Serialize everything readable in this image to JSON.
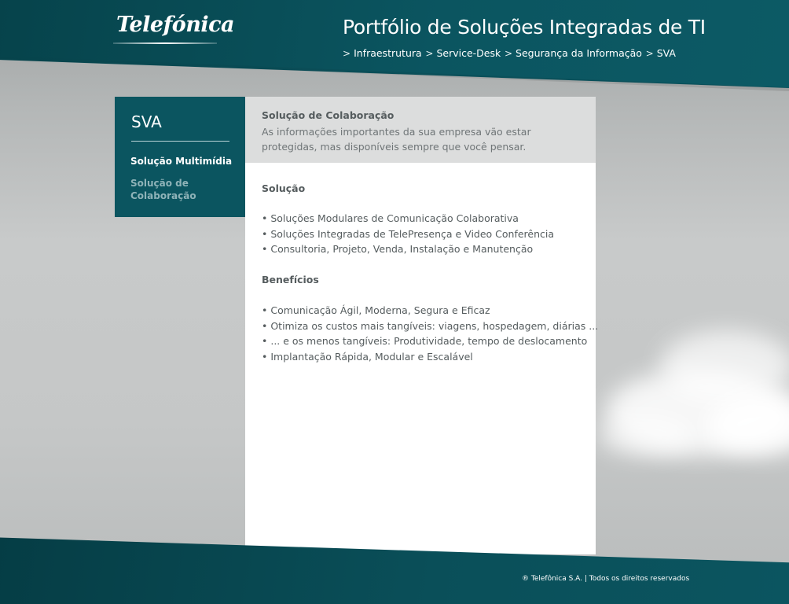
{
  "header": {
    "logo_text": "Telefónica",
    "title": "Portfólio de Soluções Integradas de TI",
    "nav": [
      {
        "label": "Infraestrutura"
      },
      {
        "label": "Service-Desk"
      },
      {
        "label": "Segurança da Informação"
      },
      {
        "label": "SVA"
      }
    ],
    "chevron": ">"
  },
  "sidebar": {
    "title": "SVA",
    "items": [
      {
        "label": "Solução Multimídia"
      },
      {
        "label": "Solução de Colaboração"
      }
    ]
  },
  "content": {
    "title": "Solução de Colaboração",
    "subtitle": "As informações importantes da sua empresa vão estar protegidas, mas disponíveis sempre que você pensar.",
    "sections": [
      {
        "heading": "Solução",
        "bullets": [
          "• Soluções Modulares de Comunicação Colaborativa",
          "• Soluções Integradas de TelePresença e Video Conferência",
          "• Consultoria, Projeto, Venda, Instalação e Manutenção"
        ]
      },
      {
        "heading": "Benefícios",
        "bullets": [
          "• Comunicação Ágil, Moderna, Segura e Eficaz",
          "• Otimiza os custos mais tangíveis: viagens, hospedagem, diárias ...",
          "• ... e os menos tangíveis: Produtividade, tempo de deslocamento",
          "• Implantação Rápida, Modular e Escalável"
        ]
      }
    ]
  },
  "footer": {
    "text": "® Telefônica S.A. | Todos os direitos reservados"
  },
  "colors": {
    "brand_teal": "#0b5560",
    "panel_header": "#dcdddd",
    "text_gray": "#555c5e"
  }
}
